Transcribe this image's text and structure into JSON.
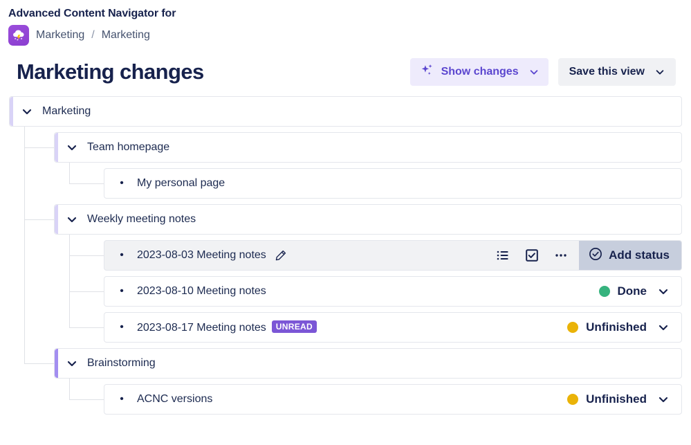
{
  "header": {
    "app_title": "Advanced Content Navigator for",
    "app_icon": "cloud-lightning-icon",
    "breadcrumb": {
      "space": "Marketing",
      "separator": "/",
      "page": "Marketing"
    },
    "page_title": "Marketing changes",
    "actions": {
      "show_changes_label": "Show changes",
      "show_changes_icon": "sparkle-icon",
      "save_view_label": "Save this view",
      "chevron_icon": "chevron-down-icon"
    }
  },
  "colors": {
    "accent_purple": "#5b46cf",
    "badge_purple": "#7b56d6",
    "row_accent_light": "#d9d3f7",
    "row_accent_strong": "#a38ef0",
    "status_done": "#36b37e",
    "status_unfinished": "#eab308",
    "add_status_bg": "#c7cedd",
    "text_dark": "#17224d"
  },
  "tree": {
    "rows": [
      {
        "id": "marketing",
        "label": "Marketing",
        "depth": 0,
        "marker": "chevron-down-icon",
        "accent": "light",
        "shaded": false
      },
      {
        "id": "team-homepage",
        "label": "Team homepage",
        "depth": 1,
        "marker": "chevron-down-icon",
        "accent": "light",
        "shaded": false
      },
      {
        "id": "my-personal-page",
        "label": "My personal page",
        "depth": 2,
        "marker": "bullet",
        "accent": "none",
        "shaded": false
      },
      {
        "id": "weekly-meeting-notes",
        "label": "Weekly meeting notes",
        "depth": 1,
        "marker": "chevron-down-icon",
        "accent": "light",
        "shaded": false
      },
      {
        "id": "meeting-notes-2023-08-03",
        "label": "2023-08-03 Meeting notes",
        "depth": 2,
        "marker": "bullet",
        "accent": "none",
        "shaded": true,
        "edit_icon": "pencil-icon",
        "toolbar": [
          {
            "name": "bullet-list-icon"
          },
          {
            "name": "checkbox-icon"
          },
          {
            "name": "more-options-icon"
          }
        ],
        "add_status_label": "Add status",
        "add_status_icon": "check-circle-icon"
      },
      {
        "id": "meeting-notes-2023-08-10",
        "label": "2023-08-10 Meeting notes",
        "depth": 2,
        "marker": "bullet",
        "accent": "none",
        "shaded": false,
        "status": {
          "label": "Done",
          "color": "#36b37e",
          "chevron": "chevron-down-icon"
        }
      },
      {
        "id": "meeting-notes-2023-08-17",
        "label": "2023-08-17 Meeting notes",
        "depth": 2,
        "marker": "bullet",
        "accent": "none",
        "shaded": false,
        "badge": "UNREAD",
        "status": {
          "label": "Unfinished",
          "color": "#eab308",
          "chevron": "chevron-down-icon"
        }
      },
      {
        "id": "brainstorming",
        "label": "Brainstorming",
        "depth": 1,
        "marker": "chevron-down-icon",
        "accent": "strong",
        "shaded": false
      },
      {
        "id": "acnc-versions",
        "label": "ACNC versions",
        "depth": 2,
        "marker": "bullet",
        "accent": "none",
        "shaded": false,
        "status": {
          "label": "Unfinished",
          "color": "#eab308",
          "chevron": "chevron-down-icon"
        }
      }
    ]
  }
}
